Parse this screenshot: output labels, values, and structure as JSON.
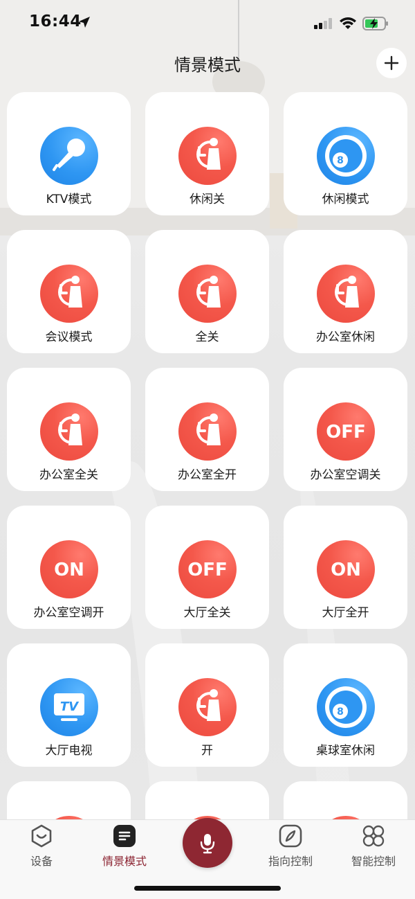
{
  "status_bar": {
    "time": "16:44"
  },
  "header": {
    "title": "情景模式"
  },
  "scenes": [
    {
      "label": "KTV模式",
      "icon": "microphone-icon",
      "color": "#2e96f2",
      "kind": "mic"
    },
    {
      "label": "休闲关",
      "icon": "clock-person-icon",
      "color": "#f4584b",
      "kind": "clock"
    },
    {
      "label": "休闲模式",
      "icon": "billiard-ball-icon",
      "color": "#2e96f2",
      "kind": "ball"
    },
    {
      "label": "会议模式",
      "icon": "clock-person-icon",
      "color": "#f4584b",
      "kind": "clock"
    },
    {
      "label": "全关",
      "icon": "clock-person-icon",
      "color": "#f4584b",
      "kind": "clock"
    },
    {
      "label": "办公室休闲",
      "icon": "clock-person-icon",
      "color": "#f4584b",
      "kind": "clock"
    },
    {
      "label": "办公室全关",
      "icon": "clock-person-icon",
      "color": "#f4584b",
      "kind": "clock"
    },
    {
      "label": "办公室全开",
      "icon": "clock-person-icon",
      "color": "#f4584b",
      "kind": "clock"
    },
    {
      "label": "办公室空调关",
      "icon": "off-icon",
      "icon_text": "OFF",
      "color": "#f4584b",
      "kind": "text"
    },
    {
      "label": "办公室空调开",
      "icon": "on-icon",
      "icon_text": "ON",
      "color": "#f4584b",
      "kind": "text"
    },
    {
      "label": "大厅全关",
      "icon": "off-icon",
      "icon_text": "OFF",
      "color": "#f4584b",
      "kind": "text"
    },
    {
      "label": "大厅全开",
      "icon": "on-icon",
      "icon_text": "ON",
      "color": "#f4584b",
      "kind": "text"
    },
    {
      "label": "大厅电视",
      "icon": "tv-icon",
      "icon_text": "TV",
      "color": "#2e96f2",
      "kind": "tv"
    },
    {
      "label": "开",
      "icon": "clock-person-icon",
      "color": "#f4584b",
      "kind": "clock"
    },
    {
      "label": "桌球室休闲",
      "icon": "billiard-ball-icon",
      "color": "#2e96f2",
      "kind": "ball"
    },
    {
      "label": "",
      "icon": "clock-person-icon",
      "color": "#f4584b",
      "kind": "clock"
    },
    {
      "label": "",
      "icon": "clock-person-icon",
      "color": "#f4584b",
      "kind": "clock"
    },
    {
      "label": "",
      "icon": "clock-person-icon",
      "color": "#f4584b",
      "kind": "clock"
    }
  ],
  "tabs": [
    {
      "label": "设备",
      "icon": "device-face-icon",
      "active": false
    },
    {
      "label": "情景模式",
      "icon": "scene-list-icon",
      "active": true
    },
    {
      "label": "指向控制",
      "icon": "compass-icon",
      "active": false
    },
    {
      "label": "智能控制",
      "icon": "grid-clover-icon",
      "active": false
    }
  ],
  "colors": {
    "accent": "#8e2732",
    "scene_red": "#f4584b",
    "scene_blue": "#2e96f2"
  }
}
